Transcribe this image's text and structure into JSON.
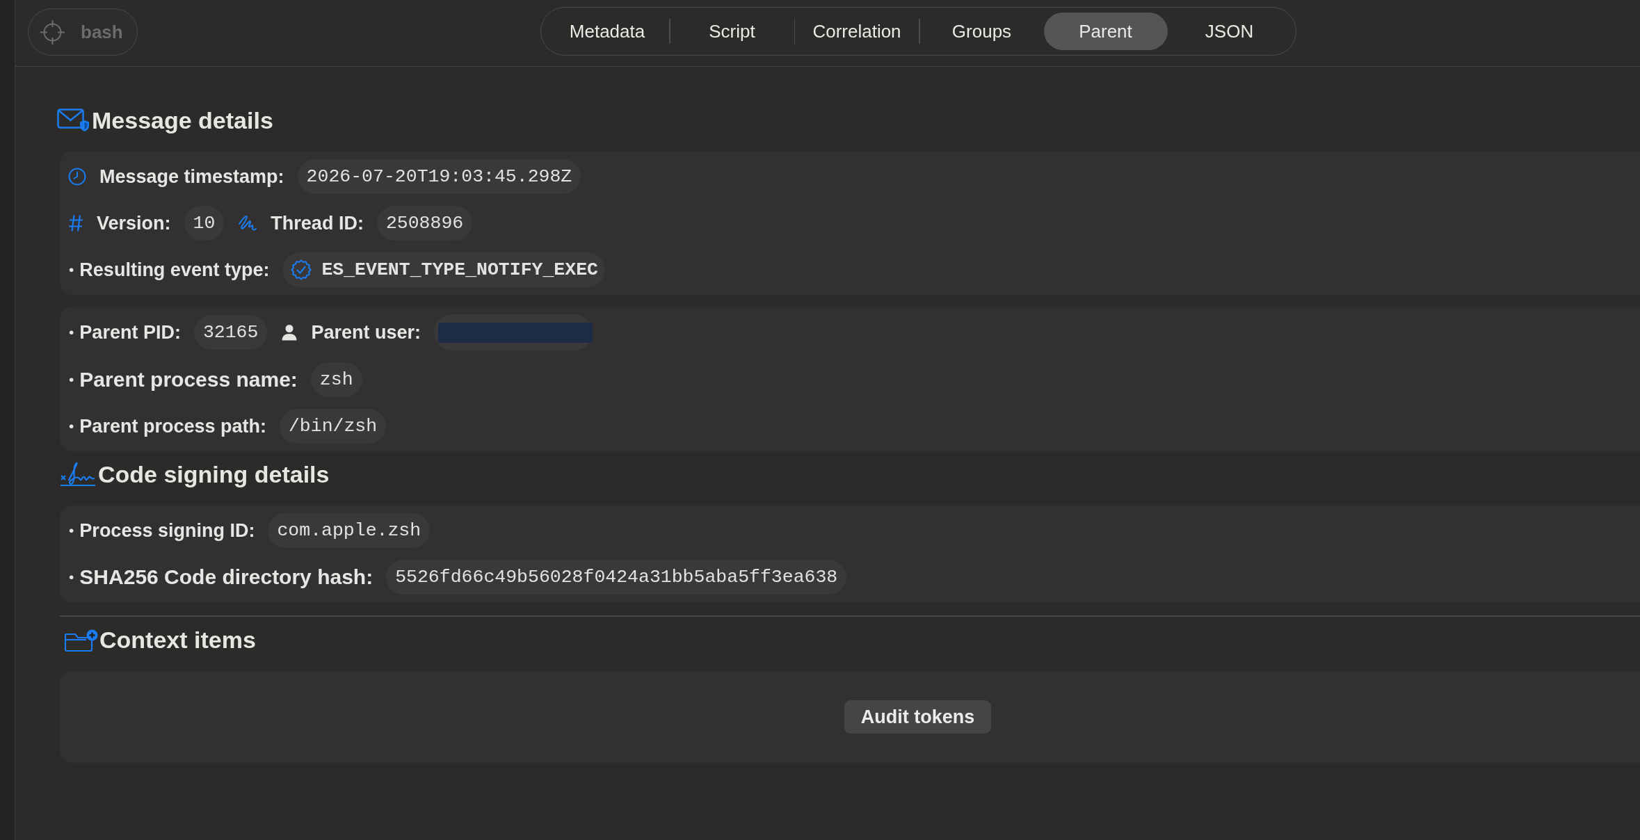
{
  "toolbar": {
    "process_button": {
      "label": "bash",
      "disabled": true
    }
  },
  "tabs": [
    {
      "label": "Metadata",
      "selected": false
    },
    {
      "label": "Script",
      "selected": false
    },
    {
      "label": "Correlation",
      "selected": false
    },
    {
      "label": "Groups",
      "selected": false
    },
    {
      "label": "Parent",
      "selected": true
    },
    {
      "label": "JSON",
      "selected": false
    }
  ],
  "sections": [
    {
      "kind": "message",
      "title": "Message details",
      "cards": [
        {
          "rows": [
            [
              {
                "kind": "time",
                "label": "Message timestamp:",
                "value": "2026-07-20T19:03:45.298Z",
                "large": false,
                "verified": false,
                "redacted": false
              }
            ],
            [
              {
                "kind": "number",
                "label": "Version:",
                "value": "10",
                "large": false,
                "verified": false,
                "redacted": false
              },
              {
                "kind": "thread",
                "label": "Thread ID:",
                "value": "2508896",
                "large": false,
                "verified": false,
                "redacted": false
              }
            ],
            [
              {
                "kind": "bullet",
                "bullet": "•",
                "label": "Resulting event type:",
                "value": "ES_EVENT_TYPE_NOTIFY_EXEC",
                "large": false,
                "verified": true,
                "redacted": false
              }
            ]
          ]
        },
        {
          "rows": [
            [
              {
                "kind": "bullet",
                "bullet": "•",
                "label": "Parent PID:",
                "value": "32165",
                "large": false,
                "verified": false,
                "redacted": false
              },
              {
                "kind": "user",
                "label": "Parent user:",
                "large": false,
                "verified": false,
                "redacted": true
              }
            ],
            [
              {
                "kind": "bullet",
                "bullet": "•",
                "label": "Parent process name:",
                "value": "zsh",
                "large": true,
                "verified": false,
                "redacted": false
              }
            ],
            [
              {
                "kind": "bullet",
                "bullet": "•",
                "label": "Parent process path:",
                "value": "/bin/zsh",
                "large": false,
                "verified": false,
                "redacted": false
              }
            ]
          ]
        }
      ]
    },
    {
      "kind": "signing",
      "title": "Code signing details",
      "cards": [
        {
          "rows": [
            [
              {
                "kind": "bullet",
                "bullet": "•",
                "label": "Process signing ID:",
                "value": "com.apple.zsh",
                "large": false,
                "verified": false,
                "redacted": false
              }
            ],
            [
              {
                "kind": "bullet",
                "bullet": "•",
                "label": "SHA256 Code directory hash:",
                "value": "5526fd66c49b56028f0424a31bb5aba5ff3ea638",
                "large": true,
                "verified": false,
                "redacted": false
              }
            ]
          ]
        }
      ]
    },
    {
      "kind": "context",
      "title": "Context items",
      "divider_before": true,
      "buttons": [
        "Audit tokens"
      ]
    }
  ]
}
